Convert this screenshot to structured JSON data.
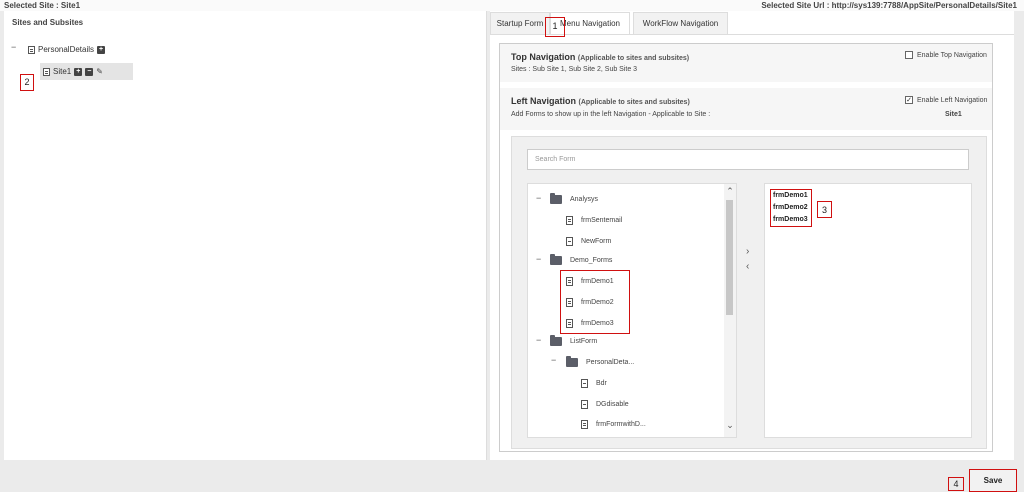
{
  "header": {
    "selected_site": "Selected Site : Site1",
    "selected_url": "Selected Site Url : http://sys139:7788/AppSite/PersonalDetails/Site1"
  },
  "left": {
    "title": "Sites and Subsites",
    "root": "PersonalDetails",
    "child": "Site1",
    "tree_toggle": "−"
  },
  "tabs": [
    {
      "label": "Startup Form"
    },
    {
      "label": "Menu Navigation",
      "active": true
    },
    {
      "label": "WorkFlow Navigation"
    }
  ],
  "top_nav": {
    "title": "Top Navigation",
    "note": "(Applicable to sites and subsites)",
    "sites": "Sites : Sub Site 1, Sub Site 2, Sub Site 3",
    "checkbox_label": "Enable Top Navigation",
    "checked": false
  },
  "left_nav": {
    "title": "Left Navigation",
    "note": "(Applicable to sites and subsites)",
    "sub": "Add Forms to show up in the left Navigation - Applicable to Site :",
    "site_name": "Site1",
    "checkbox_label": "Enable Left Navigation",
    "checked": true,
    "check_mark": "✓"
  },
  "search": {
    "placeholder": "Search Form"
  },
  "form_tree": [
    {
      "type": "folder",
      "label": "Analysys",
      "level": 0
    },
    {
      "type": "form",
      "label": "frmSentemail",
      "level": 1
    },
    {
      "type": "db",
      "label": "NewForm",
      "level": 1
    },
    {
      "type": "folder",
      "label": "Demo_Forms",
      "level": 0
    },
    {
      "type": "form",
      "label": "frmDemo1",
      "level": 1
    },
    {
      "type": "form",
      "label": "frmDemo2",
      "level": 1
    },
    {
      "type": "form",
      "label": "frmDemo3",
      "level": 1
    },
    {
      "type": "folder",
      "label": "ListForm",
      "level": 0
    },
    {
      "type": "folder",
      "label": "PersonalDeta...",
      "level": 1
    },
    {
      "type": "db",
      "label": "Bdr",
      "level": 2
    },
    {
      "type": "db",
      "label": "DGdisable",
      "level": 2
    },
    {
      "type": "form",
      "label": "frmFormwithD...",
      "level": 2
    }
  ],
  "selected_forms": [
    "frmDemo1",
    "frmDemo2",
    "frmDemo3"
  ],
  "move_right": "›",
  "move_left": "‹",
  "scroll_up": "⌃",
  "scroll_down": "⌄",
  "annotations": [
    "1",
    "2",
    "3",
    "4"
  ],
  "save_label": "Save"
}
